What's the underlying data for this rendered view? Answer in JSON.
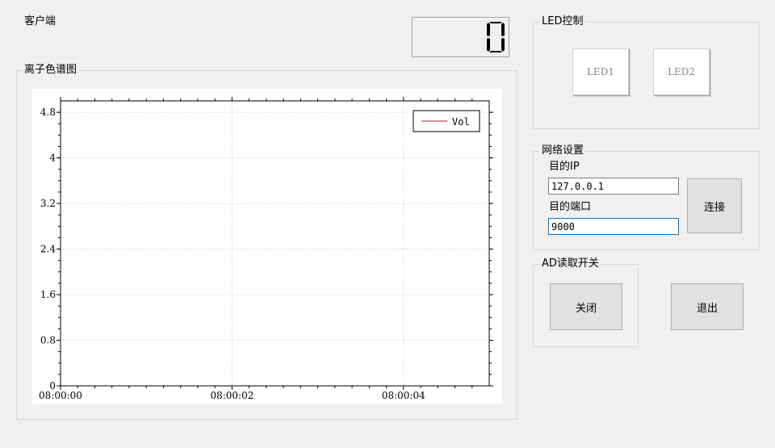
{
  "window_title": "客户端",
  "lcd": {
    "value": "0"
  },
  "chart_group": {
    "title": "离子色谱图"
  },
  "chart_data": {
    "type": "line",
    "series": [
      {
        "name": "Vol",
        "color": "#b22222",
        "values": []
      }
    ],
    "y_ticks": [
      "0",
      "0.8",
      "1.6",
      "2.4",
      "3.2",
      "4",
      "4.8"
    ],
    "x_ticks": [
      "08:00:00",
      "08:00:02",
      "08:00:04"
    ],
    "ylim": [
      0,
      5.0
    ],
    "x_range_seconds": [
      0,
      5
    ],
    "grid": true,
    "legend_position": "top-right"
  },
  "led_group": {
    "title": "LED控制",
    "led1_label": "LED1",
    "led2_label": "LED2"
  },
  "network_group": {
    "title": "网络设置",
    "ip_label": "目的IP",
    "ip_value": "127.0.0.1",
    "port_label": "目的端口",
    "port_value": "9000",
    "connect_label": "连接"
  },
  "ad_group": {
    "title": "AD读取开关",
    "toggle_label": "关闭"
  },
  "exit_label": "退出"
}
